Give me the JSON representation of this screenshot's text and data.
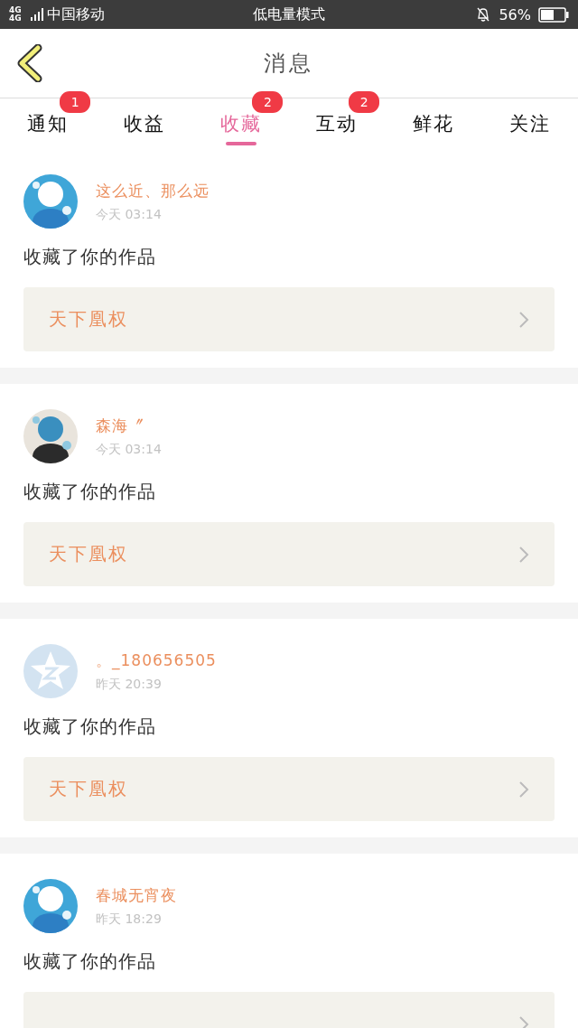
{
  "status_bar": {
    "network": "4G 4G",
    "carrier": "中国移动",
    "mode": "低电量模式",
    "battery": "56%"
  },
  "header": {
    "title": "消息"
  },
  "tabs": [
    {
      "label": "通知",
      "selected": false,
      "badge": "1"
    },
    {
      "label": "收益",
      "selected": false
    },
    {
      "label": "收藏",
      "selected": true,
      "badge": "2"
    },
    {
      "label": "互动",
      "selected": false,
      "badge": "2"
    },
    {
      "label": "鲜花",
      "selected": false
    },
    {
      "label": "关注",
      "selected": false
    }
  ],
  "messages": [
    {
      "name": "这么近、那么远",
      "time": "今天 03:14",
      "text": "收藏了你的作品",
      "work": "天下凰权"
    },
    {
      "name": "森海〞",
      "time": "今天 03:14",
      "text": "收藏了你的作品",
      "work": "天下凰权"
    },
    {
      "avatar": {
        "kind": "default"
      },
      "name": "。_180656505",
      "time": "昨天 20:39",
      "text": "收藏了你的作品",
      "work": "天下凰权"
    },
    {
      "name": "春城无宵夜",
      "time": "昨天 18:29",
      "text": "收藏了你的作品"
    }
  ]
}
